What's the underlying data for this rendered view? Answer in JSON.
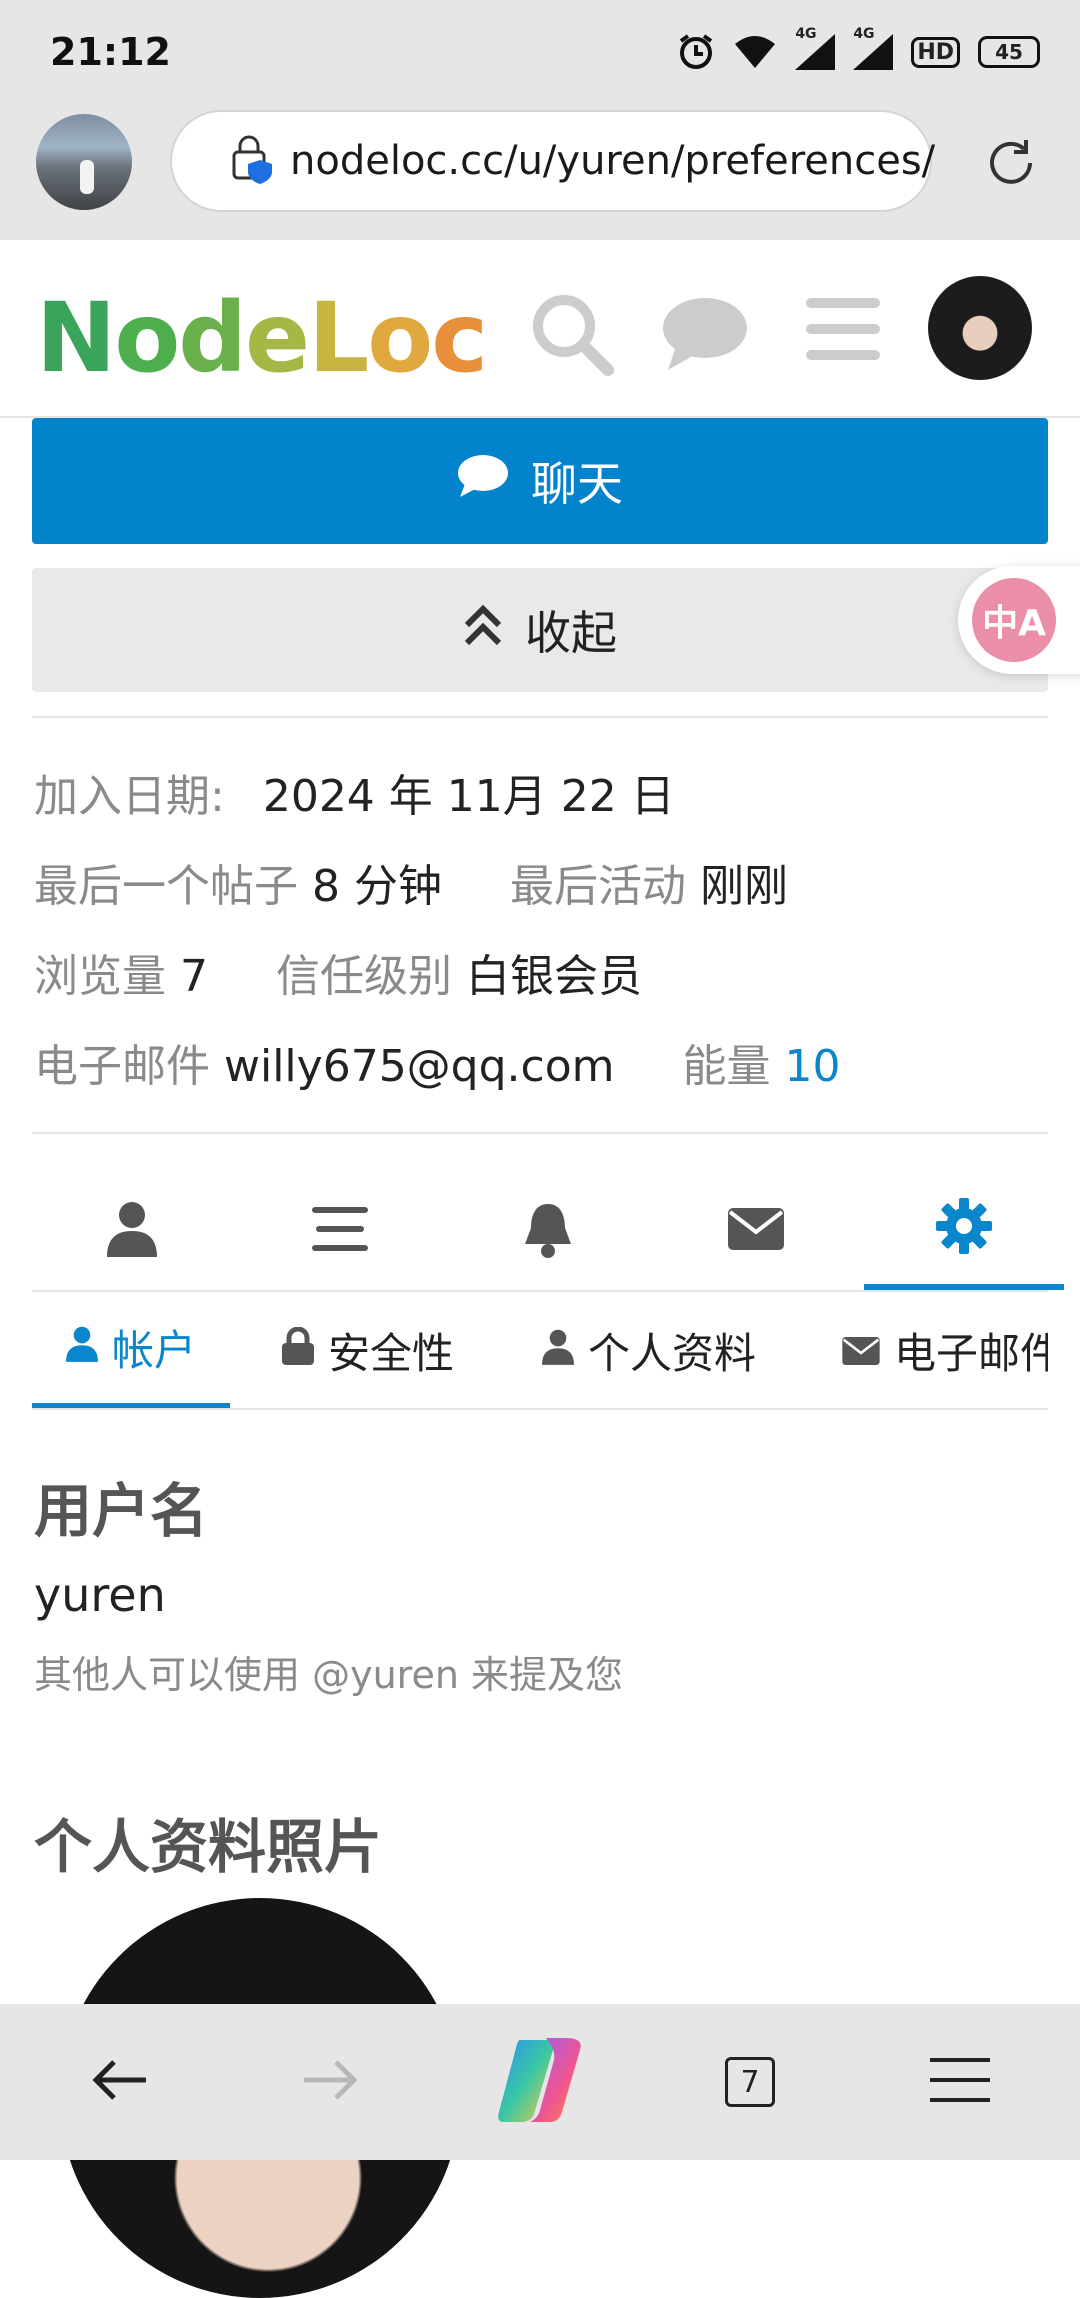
{
  "status": {
    "time": "21:12",
    "net1": "4G",
    "net2": "4G",
    "hd": "HD",
    "battery": "45"
  },
  "browser": {
    "url": "nodeloc.cc/u/yuren/preferences/"
  },
  "site": {
    "logo_letters": [
      {
        "ch": "N",
        "color": "#3aa55a"
      },
      {
        "ch": "o",
        "color": "#4cae4c"
      },
      {
        "ch": "d",
        "color": "#6ab04c"
      },
      {
        "ch": "e",
        "color": "#a3b845"
      },
      {
        "ch": "L",
        "color": "#c8b43f"
      },
      {
        "ch": "o",
        "color": "#e0a940"
      },
      {
        "ch": "c",
        "color": "#e88f3a"
      }
    ]
  },
  "actions": {
    "chat_label": "聊天",
    "collapse_label": "收起",
    "translate_label": "中A"
  },
  "stats": {
    "join_label": "加入日期:",
    "join_value": "2024 年 11月 22 日",
    "last_post_label": "最后一个帖子",
    "last_post_value": "8 分钟",
    "last_active_label": "最后活动",
    "last_active_value": "刚刚",
    "views_label": "浏览量",
    "views_value": "7",
    "trust_label": "信任级别",
    "trust_value": "白银会员",
    "email_label": "电子邮件",
    "email_value": "willy675@qq.com",
    "energy_label": "能量",
    "energy_value": "10"
  },
  "pref_tabs": {
    "account": "帐户",
    "security": "安全性",
    "profile": "个人资料",
    "email": "电子邮件"
  },
  "account": {
    "username_title": "用户名",
    "username_value": "yuren",
    "username_hint": "其他人可以使用 @yuren 来提及您",
    "photo_title": "个人资料照片"
  },
  "bottom": {
    "tab_count": "7"
  }
}
